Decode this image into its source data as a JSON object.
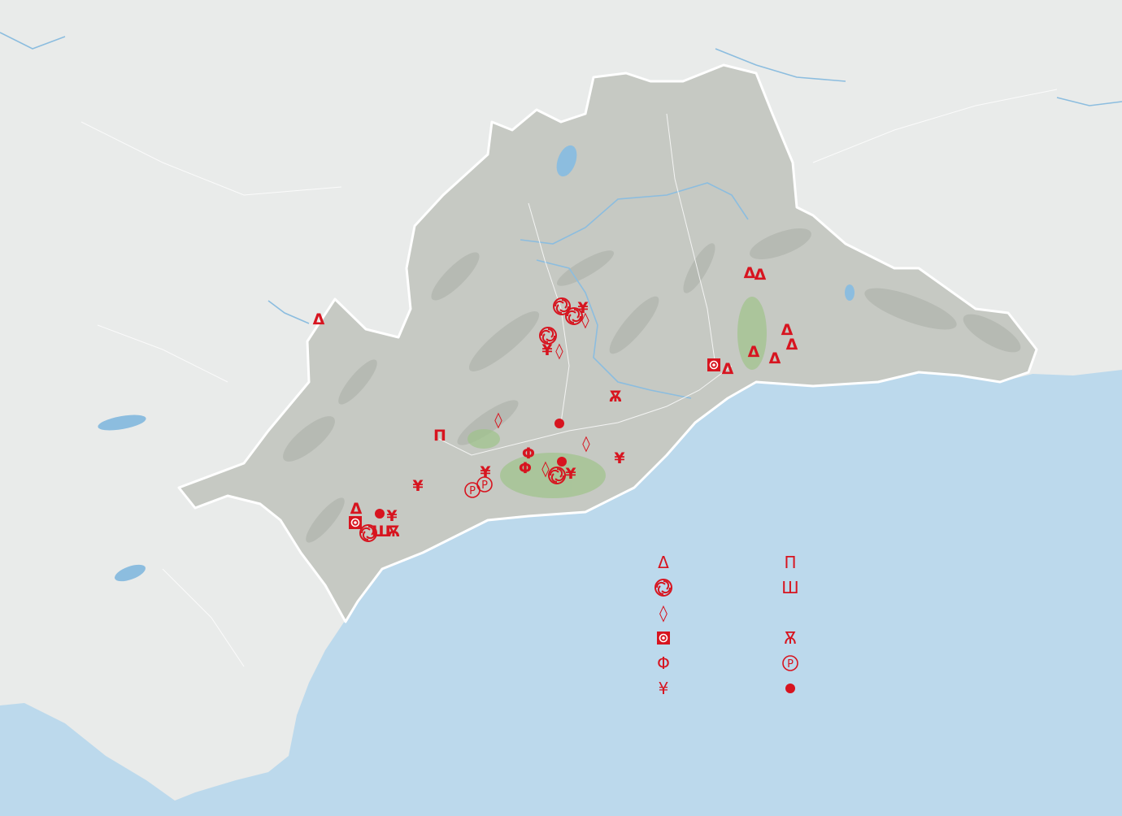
{
  "map": {
    "accent_color": "#d7141f",
    "sea_color": "#bcd9ec",
    "land_color": "#e9ebea",
    "province_color": "#c6c9c3",
    "border_color": "#ffffff",
    "river_color": "#8cbddf"
  },
  "markers": [
    {
      "symbol": "Δ",
      "kind": "triangle"
    },
    {
      "symbol": "Δ",
      "kind": "triangle"
    },
    {
      "symbol": "Δ",
      "kind": "triangle"
    },
    {
      "symbol": "Δ",
      "kind": "triangle"
    },
    {
      "symbol": "Δ",
      "kind": "triangle"
    },
    {
      "symbol": "Δ",
      "kind": "triangle"
    },
    {
      "symbol": "Δ",
      "kind": "triangle"
    },
    {
      "symbol": "Δ",
      "kind": "triangle"
    },
    {
      "symbol": "Δ",
      "kind": "triangle"
    },
    {
      "symbol": "¥",
      "kind": "yen"
    },
    {
      "symbol": "¥",
      "kind": "yen"
    },
    {
      "symbol": "¥",
      "kind": "yen"
    },
    {
      "symbol": "¥",
      "kind": "yen"
    },
    {
      "symbol": "¥",
      "kind": "yen"
    },
    {
      "symbol": "¥",
      "kind": "yen"
    },
    {
      "symbol": "¥",
      "kind": "yen"
    },
    {
      "symbol": "◊",
      "kind": "diamond"
    },
    {
      "symbol": "◊",
      "kind": "diamond"
    },
    {
      "symbol": "◊",
      "kind": "diamond"
    },
    {
      "symbol": "◊",
      "kind": "diamond"
    },
    {
      "symbol": "◊",
      "kind": "diamond"
    },
    {
      "symbol": "Φ",
      "kind": "phi"
    },
    {
      "symbol": "Φ",
      "kind": "phi"
    },
    {
      "symbol": "Π",
      "kind": "pi"
    },
    {
      "symbol": "Ѫ",
      "kind": "yus"
    },
    {
      "symbol": "Ѫ",
      "kind": "yus"
    },
    {
      "symbol": "Ш",
      "kind": "w"
    },
    {
      "symbol": "Ⓟ",
      "kind": "circled-p"
    },
    {
      "symbol": "Ⓟ",
      "kind": "circled-p"
    },
    {
      "symbol": "●",
      "kind": "dot"
    },
    {
      "symbol": "●",
      "kind": "dot"
    },
    {
      "symbol": "●",
      "kind": "dot"
    },
    {
      "symbol": "◙",
      "kind": "square-dot"
    },
    {
      "symbol": "◙",
      "kind": "square-dot"
    },
    {
      "symbol": "֍",
      "kind": "swirl"
    },
    {
      "symbol": "֍",
      "kind": "swirl"
    },
    {
      "symbol": "֍",
      "kind": "swirl"
    },
    {
      "symbol": "֍",
      "kind": "swirl"
    },
    {
      "symbol": "֍",
      "kind": "swirl"
    }
  ],
  "legend": {
    "left": [
      {
        "symbol": "Δ",
        "kind": "triangle"
      },
      {
        "symbol": "֍",
        "kind": "swirl"
      },
      {
        "symbol": "◊",
        "kind": "diamond"
      },
      {
        "symbol": "◙",
        "kind": "square-dot"
      },
      {
        "symbol": "Φ",
        "kind": "phi"
      },
      {
        "symbol": "¥",
        "kind": "yen"
      }
    ],
    "right": [
      {
        "symbol": "Π",
        "kind": "pi"
      },
      {
        "symbol": "Ш",
        "kind": "w"
      },
      {
        "symbol": "Ѫ",
        "kind": "yus"
      },
      {
        "symbol": "Ⓟ",
        "kind": "circled-p"
      },
      {
        "symbol": "●",
        "kind": "dot"
      }
    ]
  }
}
